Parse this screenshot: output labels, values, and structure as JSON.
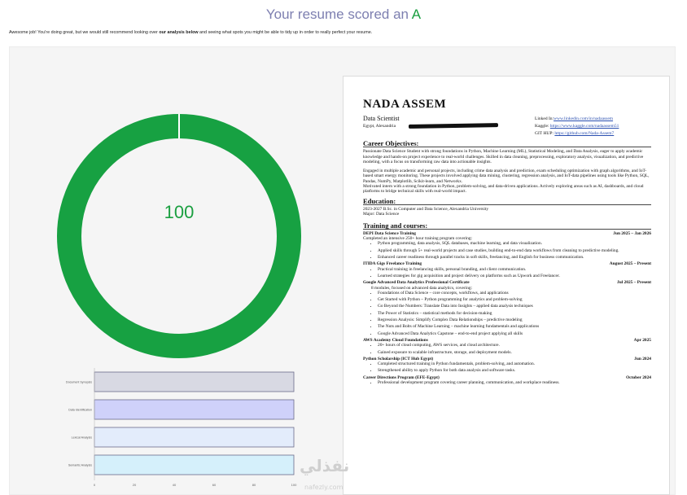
{
  "header": {
    "title_prefix": "Your resume scored an ",
    "grade": "A",
    "intro_part1": "Awesome job! You're doing great, but we would still recommend looking over ",
    "intro_bold": "our analysis below",
    "intro_part2": " and seeing what spots you might be able to tidy up in order to really perfect your resume."
  },
  "score": {
    "value": "100",
    "fraction": 1.0,
    "color": "#17a142"
  },
  "chart_data": {
    "type": "bar",
    "orientation": "horizontal",
    "categories": [
      "Document Synopsis",
      "Data Identification",
      "Lexical Analysis",
      "Semantic Analysis"
    ],
    "values": [
      100,
      100,
      100,
      100
    ],
    "colors": [
      "#d8d9e3",
      "#cfd1fa",
      "#e3ecfb",
      "#d5f0fb"
    ],
    "xlim": [
      0,
      100
    ],
    "xticks": [
      "0",
      "20",
      "40",
      "60",
      "80",
      "100"
    ],
    "title": "",
    "xlabel": "",
    "ylabel": ""
  },
  "resume": {
    "name": "NADA ASSEM",
    "role": "Data Scientist",
    "location": "Egypt, Alexandria",
    "linkedin_label": "Linked In:",
    "linkedin_url": "www.linkedin.com/in/nadaassem",
    "kaggle_label": "Kaggle: ",
    "kaggle_url": "https://www.kaggle.com/nadaassem51",
    "github_label": "GIT HUP: ",
    "github_url": "https://github.com/Nada-Assem7",
    "objectives_title": "Career Objectives:",
    "objective_1": "Passionate Data Science Student with strong foundations in Python, Machine Learning (ML), Statistical Modeling, and Data Analysis, eager to apply academic knowledge and hands-on project experience to real-world challenges. Skilled in data cleaning, preprocessing, exploratory analysis, visualization, and predictive modeling, with a focus on transforming raw data into actionable insights.",
    "objective_2": "Engaged in multiple academic and personal projects, including crime data analysis and prediction, exam scheduling optimization with graph algorithms, and IoT-based smart energy monitoring. These projects involved applying data mining, clustering, regression analysis, and IoT-data pipelines using tools like Python, SQL, Pandas, NumPy, Matplotlib, Scikit-learn, and Networkx.",
    "objective_3": "Motivated intern with a strong foundation in Python, problem-solving, and data-driven applications. Actively exploring areas such as AI, dashboards, and cloud platforms to bridge technical skills with real-world impact.",
    "education_title": "Education:",
    "edu_degree": "2023-2027 B.Sc. in Computer and Data Science, Alexandria University",
    "edu_major": "Major: Data Science",
    "training_title": "Training and courses:",
    "t1_name": "DEPI Data Science Training",
    "t1_date": "Jun 2025 – Jan 2026",
    "t1_desc": "Completed an intensive 250+ hour training program covering:",
    "t1_b1": "Python programming, data analysis, SQL databases, machine learning, and data visualization.",
    "t1_b2": "Applied skills through 5+ real-world projects and case studies, building end-to-end data workflows from cleaning to predictive modeling.",
    "t1_b3": "Enhanced career readiness through parallel tracks in soft skills, freelancing, and English for business communication.",
    "t2_name": "ITIDA Gigs Freelance Training",
    "t2_date": "August 2025 – Present",
    "t2_b1": "Practical training in freelancing skills, personal branding, and client communication.",
    "t2_b2": "Learned strategies for gig acquisition and project delivery on platforms such as Upwork and Freelancer.",
    "t3_name": "Google Advanced Data Analytics Professional Certificate",
    "t3_date": "Jul 2025 – Present",
    "t3_desc": "8 modules, focused on advanced data analytics, covering:",
    "t3_b1": "Foundations of Data Science – core concepts, workflows, and applications",
    "t3_b2": "Get Started with Python – Python programming for analytics and problem-solving",
    "t3_b3": "Go Beyond the Numbers: Translate Data into Insights – applied data analysis techniques",
    "t3_b4": "The Power of Statistics – statistical methods for decision-making",
    "t3_b5": "Regression Analysis: Simplify Complex Data Relationships – predictive modeling",
    "t3_b6": "The Nuts and Bolts of Machine Learning – machine learning fundamentals and applications",
    "t3_b7": "Google Advanced Data Analytics Capstone – end-to-end project applying all skills",
    "t4_name": "AWS Academy Cloud Foundations",
    "t4_date": "Apr 2025",
    "t4_b1": "20+ hours of cloud computing, AWS services, and cloud architecture.",
    "t4_b2": "Gained exposure to scalable infrastructure, storage, and deployment models.",
    "t5_name": "Python Scholarship (ICT Hub Egypt)",
    "t5_date": "Jun 2024",
    "t5_b1": "Completed structured training in Python fundamentals, problem-solving, and automation.",
    "t5_b2": "Strengthened ability to apply Python for both data analysis and software tasks.",
    "t6_name": "Career Directions Program (EFE-Egypt)",
    "t6_date": "October 2024",
    "t6_b1": "Professional development program covering career planning, communication, and workplace readiness."
  },
  "watermark": {
    "logo": "نفذلي",
    "site": "nafezly.com"
  }
}
